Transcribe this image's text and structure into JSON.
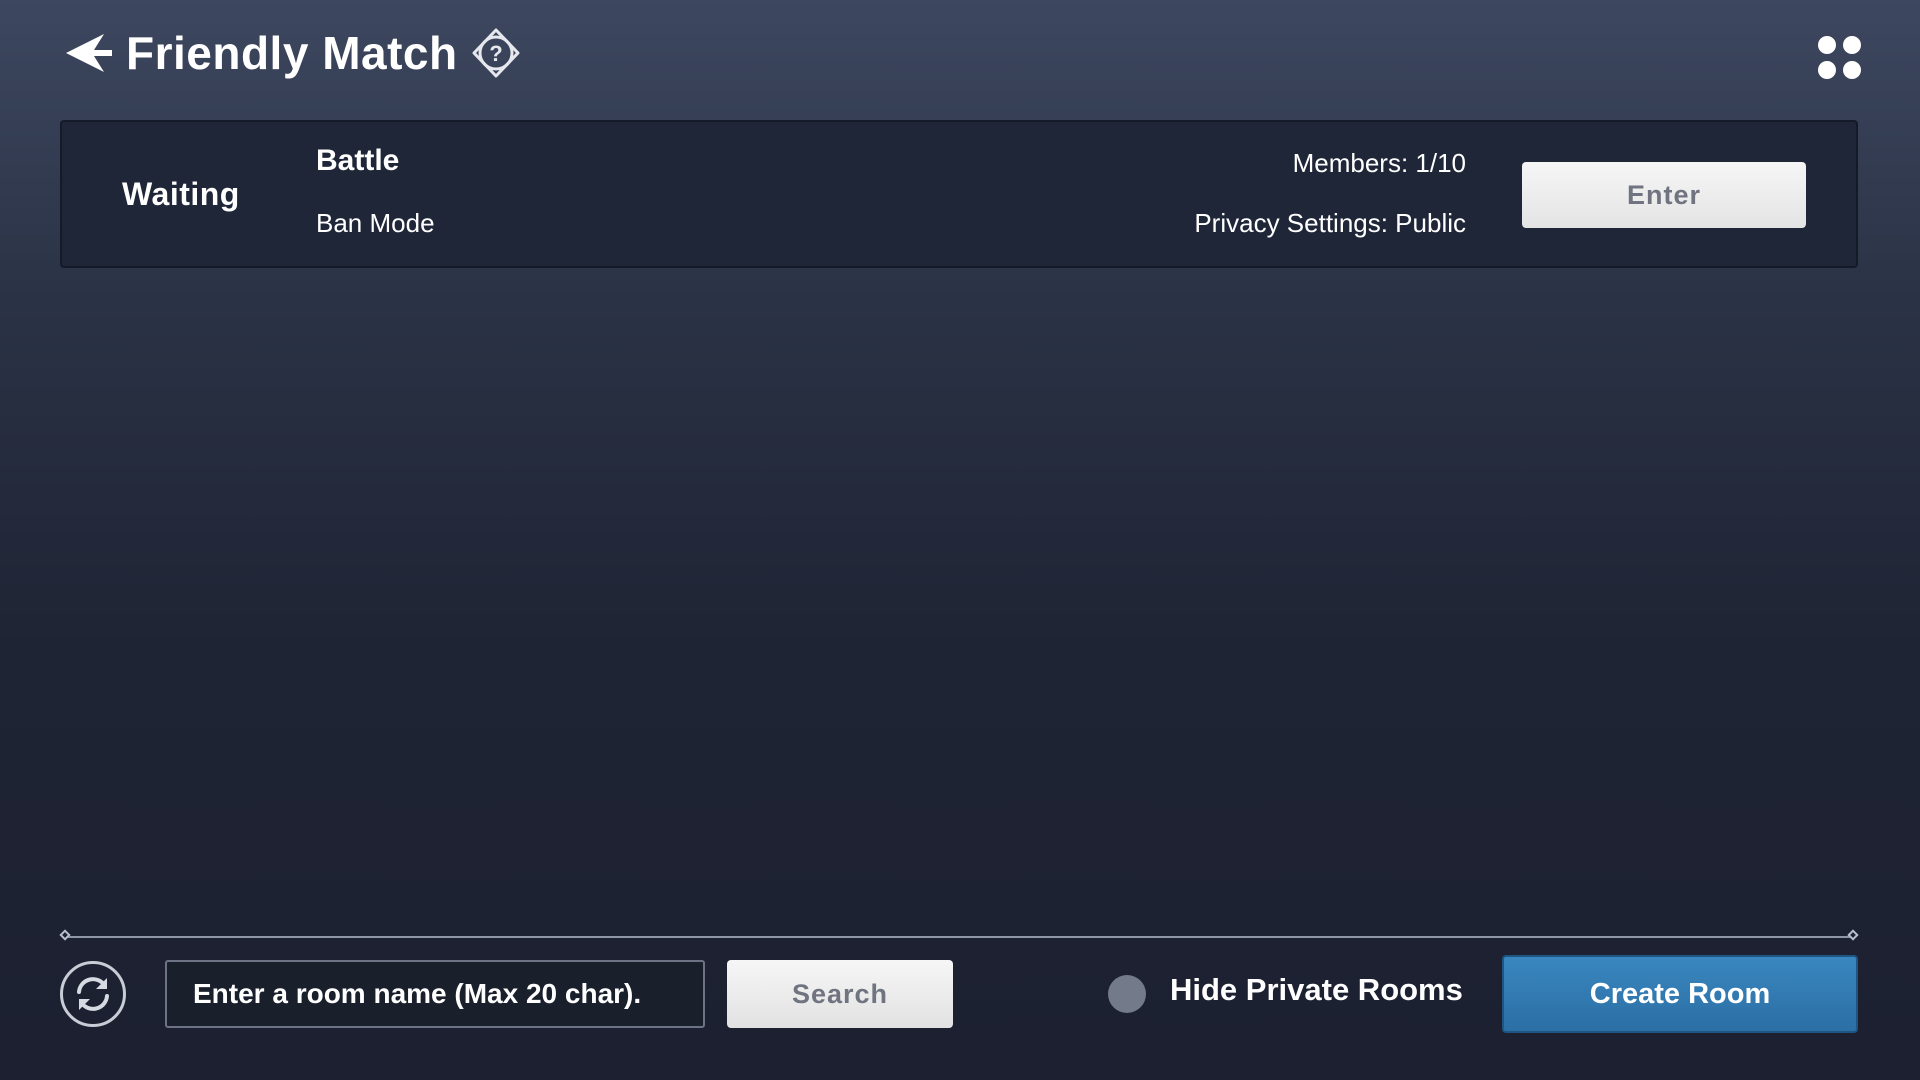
{
  "header": {
    "title": "Friendly Match",
    "back_icon": "back-arrow-icon",
    "help_icon": "help-icon",
    "menu_icon": "grid-menu-icon"
  },
  "rooms": [
    {
      "status": "Waiting",
      "mode": "Battle",
      "sub_mode": "Ban Mode",
      "members": "Members: 1/10",
      "privacy": "Privacy Settings: Public",
      "enter_label": "Enter"
    }
  ],
  "footer": {
    "refresh_icon": "refresh-icon",
    "search_placeholder": "Enter a room name (Max 20 char).",
    "search_value": "",
    "search_label": "Search",
    "hide_private_label": "Hide Private Rooms",
    "hide_private_checked": false,
    "create_room_label": "Create Room"
  },
  "colors": {
    "accent": "#2f78b0",
    "toggle_off": "#737a8a",
    "button_text": "#6f7480"
  }
}
